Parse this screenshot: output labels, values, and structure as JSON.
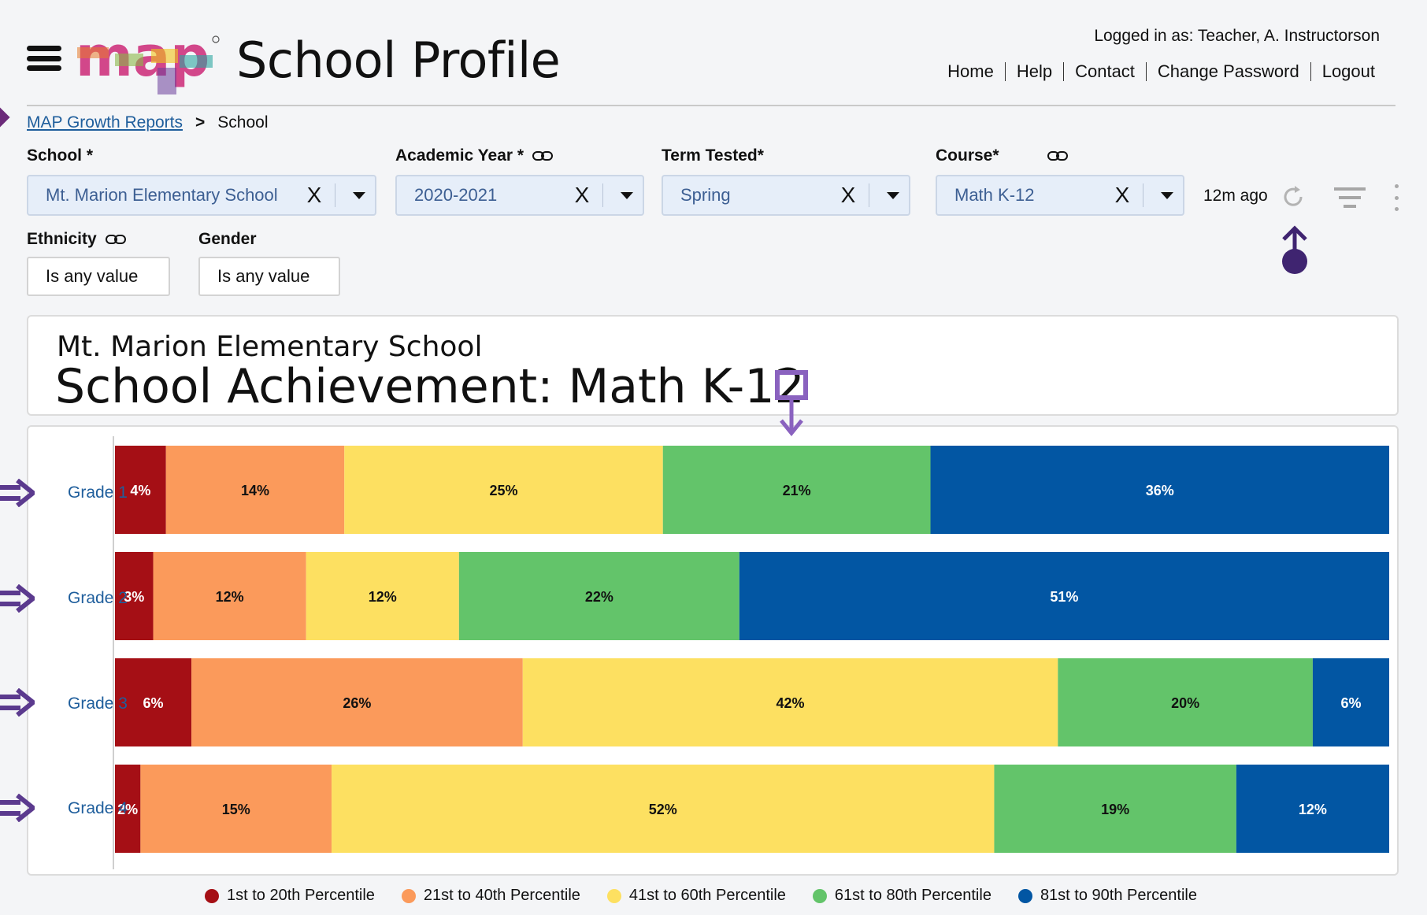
{
  "header": {
    "title": "School Profile",
    "logo_text": "map",
    "logged_in": "Logged in as:  Teacher, A. Instructorson",
    "nav": [
      "Home",
      "Help",
      "Contact",
      "Change Password",
      "Logout"
    ]
  },
  "breadcrumb": {
    "link": "MAP Growth Reports",
    "separator": ">",
    "current": "School"
  },
  "filters": {
    "school": {
      "label": "School *",
      "value": "Mt. Marion Elementary School"
    },
    "academic_year": {
      "label": "Academic Year *",
      "value": "2020-2021"
    },
    "term": {
      "label": "Term Tested*",
      "value": "Spring"
    },
    "course": {
      "label": "Course*",
      "value": "Math K-12"
    },
    "ethnicity": {
      "label": "Ethnicity",
      "value": "Is any value"
    },
    "gender": {
      "label": "Gender",
      "value": "Is any value"
    },
    "clear_symbol": "X",
    "refresh_time": "12m ago"
  },
  "card": {
    "school_name": "Mt. Marion Elementary School",
    "title": "School Achievement: Math K-12"
  },
  "colors": {
    "p1": "#a50f15",
    "p2": "#fb9a5b",
    "p3": "#fde061",
    "p4": "#63c46a",
    "p5": "#0256a3",
    "accent": "#6a3d9a",
    "link": "#1f5e9c"
  },
  "chart_data": {
    "type": "bar",
    "orientation": "horizontal",
    "stacked": true,
    "categories": [
      "Grade 1",
      "Grade 2",
      "Grade 3",
      "Grade 4"
    ],
    "series": [
      {
        "name": "1st to 20th Percentile",
        "values": [
          4,
          3,
          6,
          2
        ],
        "labels": [
          "4%",
          "3%",
          "6%",
          "2%"
        ]
      },
      {
        "name": "21st to 40th Percentile",
        "values": [
          14,
          12,
          26,
          15
        ],
        "labels": [
          "14%",
          "12%",
          "26%",
          "15%"
        ]
      },
      {
        "name": "41st to 60th Percentile",
        "values": [
          25,
          12,
          42,
          52
        ],
        "labels": [
          "25%",
          "12%",
          "42%",
          "52%"
        ]
      },
      {
        "name": "61st to 80th Percentile",
        "values": [
          21,
          22,
          20,
          19
        ],
        "labels": [
          "21%",
          "22%",
          "20%",
          "19%"
        ]
      },
      {
        "name": "81st to 90th Percentile",
        "values": [
          36,
          51,
          6,
          12
        ],
        "labels": [
          "36%",
          "51%",
          "6%",
          "12%"
        ]
      }
    ],
    "legend_position": "bottom",
    "grid": false
  }
}
